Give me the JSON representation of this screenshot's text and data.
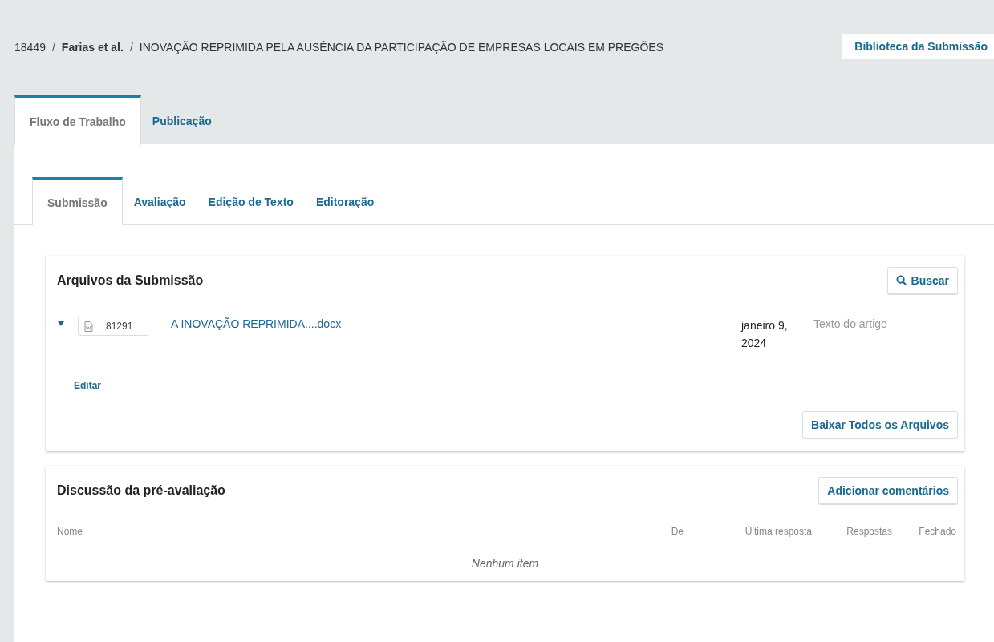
{
  "breadcrumb": {
    "separator": "/",
    "items": [
      {
        "text": "18449",
        "bold": false
      },
      {
        "text": "Farias et al.",
        "bold": true
      },
      {
        "text": "INOVAÇÃO REPRIMIDA PELA AUSÊNCIA DA PARTICIPAÇÃO DE EMPRESAS LOCAIS EM PREGÕES",
        "bold": false
      }
    ]
  },
  "library_button": "Biblioteca da Submissão",
  "main_tabs": [
    {
      "label": "Fluxo de Trabalho",
      "selected": true
    },
    {
      "label": "Publicação",
      "selected": false
    }
  ],
  "stage_tabs": [
    {
      "label": "Submissão",
      "selected": true
    },
    {
      "label": "Avaliação",
      "selected": false
    },
    {
      "label": "Edição de Texto",
      "selected": false
    },
    {
      "label": "Editoração",
      "selected": false
    }
  ],
  "files_panel": {
    "title": "Arquivos da Submissão",
    "search_button": "Buscar",
    "rows": [
      {
        "expanded": true,
        "id": "81291",
        "name": "A INOVAÇÃO REPRIMIDA....docx",
        "date": "janeiro 9, 2024",
        "type": "Texto do artigo",
        "action": "Editar"
      }
    ],
    "footer_button": "Baixar Todos os Arquivos"
  },
  "discussion_panel": {
    "title": "Discussão da pré-avaliação",
    "add_button": "Adicionar comentários",
    "columns": [
      "Nome",
      "De",
      "Última resposta",
      "Respostas",
      "Fechado"
    ],
    "empty": "Nenhum item"
  }
}
